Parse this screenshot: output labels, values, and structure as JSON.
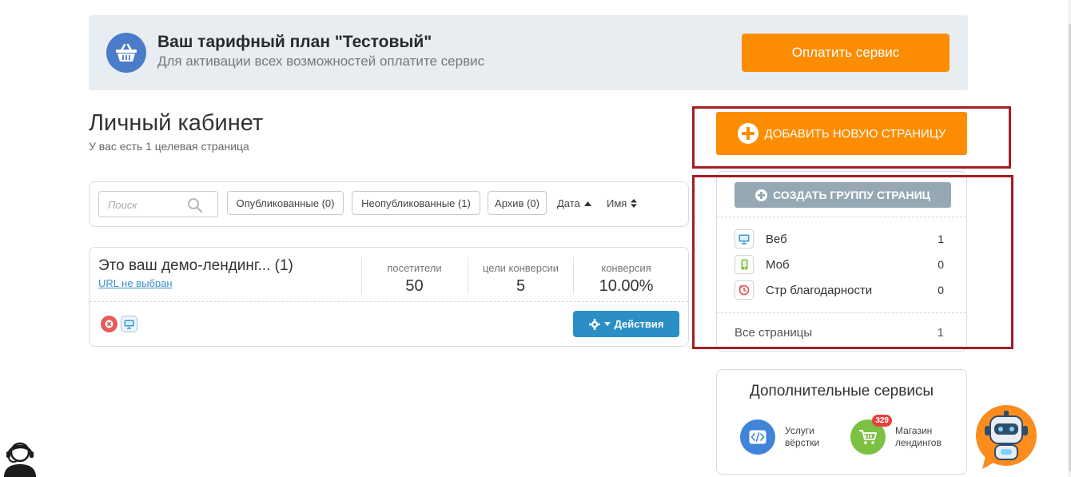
{
  "banner": {
    "title": "Ваш тарифный план \"Тестовый\"",
    "subtitle": "Для активации всех возможностей оплатите сервис",
    "pay_label": "Оплатить сервис",
    "icon": "basket-icon"
  },
  "header": {
    "title": "Личный кабинет",
    "subtitle": "У вас есть 1 целевая страница"
  },
  "filters": {
    "search_placeholder": "Поиск",
    "published": "Опубликованные (0)",
    "unpublished": "Неопубликованные (1)",
    "archive": "Архив (0)",
    "sort_date": "Дата",
    "sort_name": "Имя"
  },
  "page_card": {
    "title": "Это ваш демо-лендинг... (1)",
    "url_label": "URL не выбран",
    "stats": [
      {
        "label": "посетители",
        "value": "50"
      },
      {
        "label": "цели конверсии",
        "value": "5"
      },
      {
        "label": "конверсия",
        "value": "10.00%"
      }
    ],
    "actions_label": "Действия"
  },
  "sidebar": {
    "add_page_label": "ДОБАВИТЬ НОВУЮ СТРАНИЦУ",
    "create_group_label": "СОЗДАТЬ ГРУППУ СТРАНИЦ",
    "groups": [
      {
        "label": "Веб",
        "count": "1",
        "icon": "desktop-icon"
      },
      {
        "label": "Моб",
        "count": "0",
        "icon": "mobile-icon"
      },
      {
        "label": "Стр благодарности",
        "count": "0",
        "icon": "thanks-icon"
      }
    ],
    "all_pages": {
      "label": "Все страницы",
      "count": "1"
    }
  },
  "services": {
    "title": "Дополнительные сервисы",
    "items": [
      {
        "line1": "Услуги",
        "line2": "вёрстки",
        "icon": "code-icon",
        "color": "#3f84d9"
      },
      {
        "line1": "Магазин",
        "line2": "лендингов",
        "icon": "cart-icon",
        "color": "#7cc142",
        "badge": "329"
      }
    ]
  },
  "colors": {
    "accent_orange": "#fc8d03",
    "action_blue": "#2b8fc6",
    "highlight_red": "#a51d24",
    "group_button_gray": "#95a8b3"
  }
}
